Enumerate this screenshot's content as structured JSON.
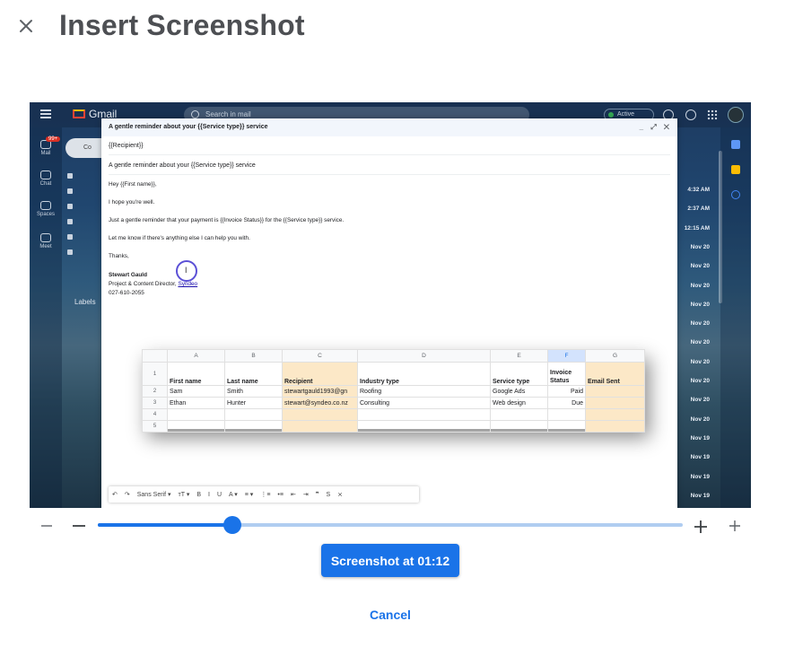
{
  "dialog": {
    "title": "Insert Screenshot",
    "close_icon": "close-icon"
  },
  "preview": {
    "gmail": {
      "logo_text": "Gmail",
      "search_placeholder": "Search in mail",
      "status": "Active",
      "rail": [
        {
          "label": "Mail",
          "icon": "mail-icon"
        },
        {
          "label": "Chat",
          "icon": "chat-icon"
        },
        {
          "label": "Spaces",
          "icon": "spaces-icon"
        },
        {
          "label": "Meet",
          "icon": "meet-icon"
        }
      ],
      "unread_badge": "99+",
      "compose_label": "Co",
      "labels_heading": "Labels",
      "times": [
        "4:32 AM",
        "2:37 AM",
        "12:15 AM",
        "Nov 20",
        "Nov 20",
        "Nov 20",
        "Nov 20",
        "Nov 20",
        "Nov 20",
        "Nov 20",
        "Nov 20",
        "Nov 20",
        "Nov 20",
        "Nov 19",
        "Nov 19",
        "Nov 19",
        "Nov 19"
      ]
    },
    "compose": {
      "header": "A gentle reminder about your {{Service type}} service",
      "controls": "_ ⤢ ✕",
      "recipient": "{{Recipient}}",
      "subject": "A gentle reminder about your {{Service type}} service",
      "body": [
        "Hey {{First name}},",
        "I hope you're well.",
        "Just a gentle reminder that your payment is {{Invoice Status}} for the {{Service type}} service.",
        "Let me know if there's anything else I can help you with.",
        "Thanks,"
      ],
      "signature": {
        "name": "Stewart Gauld",
        "role": "Project & Content Director, ",
        "company": "Syndeo",
        "phone": "027-610-2055"
      },
      "toolbar": {
        "font": "Sans Serif",
        "items": [
          "↶",
          "↷",
          "Sans Serif ▾",
          "тT ▾",
          "B",
          "I",
          "U",
          "A ▾",
          "≡ ▾",
          "⋮≡",
          "•≡",
          "⇤",
          "⇥",
          "❞",
          "S",
          "⨯"
        ]
      }
    },
    "sheet": {
      "columns": [
        "A",
        "B",
        "C",
        "D",
        "E",
        "F",
        "G"
      ],
      "row_numbers": [
        "1",
        "2",
        "3",
        "4",
        "5"
      ],
      "headers": [
        "First name",
        "Last name",
        "Recipient",
        "Industry type",
        "Service type",
        "Invoice Status",
        "Email Sent"
      ],
      "rows": [
        [
          "Sam",
          "Smith",
          "stewartgauld1993@gn",
          "Roofing",
          "Google Ads",
          "Paid",
          ""
        ],
        [
          "Ethan",
          "Hunter",
          "stewart@syndeo.co.nz",
          "Consulting",
          "Web design",
          "Due",
          ""
        ]
      ]
    }
  },
  "slider": {
    "position": 0.23,
    "zoom_out_icon": "minus-icon",
    "zoom_in_icon": "plus-icon"
  },
  "actions": {
    "primary": "Screenshot at 01:12",
    "cancel": "Cancel"
  },
  "colors": {
    "accent": "#1a73e8",
    "track": "#b0cdf1",
    "title": "#4d4f53",
    "highlight": "#fce8c7"
  }
}
